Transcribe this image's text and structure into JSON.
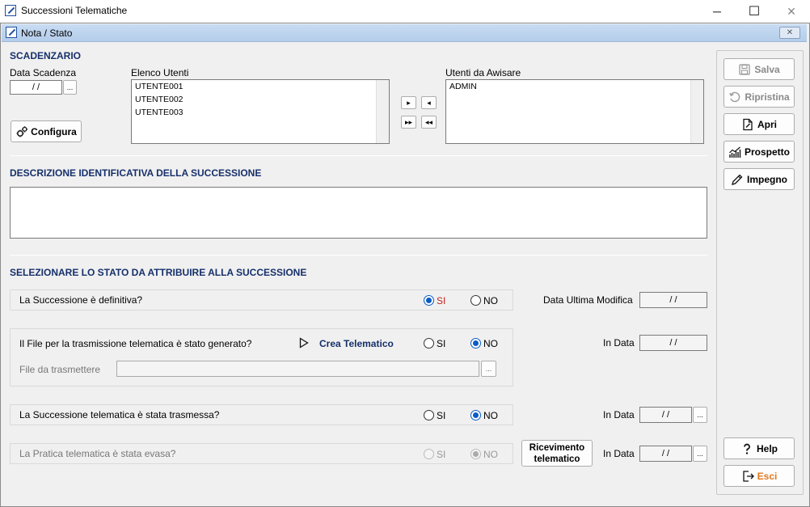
{
  "window": {
    "title": "Successioni Telematiche",
    "minimize": "─",
    "maximize": "☐",
    "close": "✕"
  },
  "dialog": {
    "title": "Nota / Stato",
    "close": "✕"
  },
  "scadenzario": {
    "title": "SCADENZARIO",
    "data_scadenza_label": "Data Scadenza",
    "data_scadenza_value": "/ /",
    "ellipsis": "...",
    "elenco_utenti_label": "Elenco Utenti",
    "elenco_utenti": [
      "UTENTE001",
      "UTENTE002",
      "UTENTE003"
    ],
    "utenti_avvisare_label": "Utenti da Awisare",
    "utenti_avvisare": [
      "ADMIN"
    ],
    "configura_label": "Configura",
    "move_right": "▸",
    "move_left": "◂",
    "move_all_right": "▸▸",
    "move_all_left": "◂◂"
  },
  "descrizione": {
    "title": "DESCRIZIONE IDENTIFICATIVA DELLA SUCCESSIONE",
    "value": ""
  },
  "stato": {
    "title": "SELEZIONARE LO STATO DA ATTRIBUIRE ALLA SUCCESSIONE",
    "si": "SI",
    "no": "NO",
    "q1": "La Successione è definitiva?",
    "q1_selected": "SI",
    "data_ultima_modifica_label": "Data Ultima Modifica",
    "data_ultima_modifica_value": "/ /",
    "q2": "Il File per la trasmissione telematica è stato generato?",
    "crea_telematico": "Crea Telematico",
    "q2_selected": "NO",
    "in_data_label": "In Data",
    "in_data_value": "/ /",
    "file_label": "File da trasmettere",
    "file_value": "",
    "q3": "La Successione telematica è stata trasmessa?",
    "q3_selected": "NO",
    "q4": "La Pratica telematica è stata evasa?",
    "q4_selected": "NO",
    "ricevimento_line1": "Ricevimento",
    "ricevimento_line2": "telematico"
  },
  "sidebar": {
    "salva": "Salva",
    "ripristina": "Ripristina",
    "apri": "Apri",
    "prospetto": "Prospetto",
    "impegno": "Impegno",
    "help": "Help",
    "esci": "Esci",
    "esci_color": "#e07a1f"
  }
}
